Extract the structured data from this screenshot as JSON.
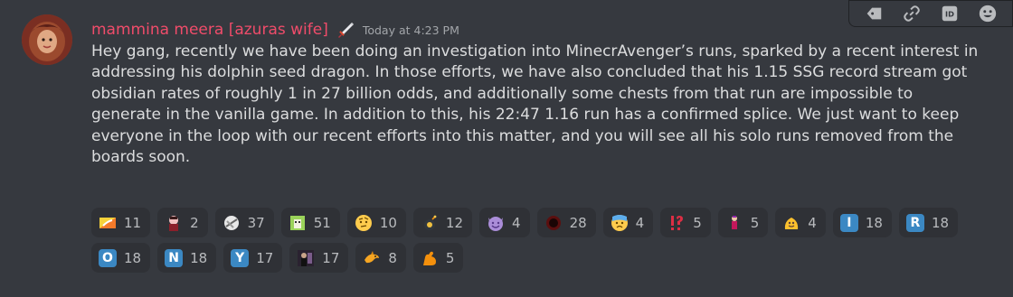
{
  "message": {
    "username": "mammina meera [azuras wife]",
    "timestamp": "Today at 4:23 PM",
    "content": "Hey gang, recently we have been doing an investigation into MinecrAvenger’s runs, sparked by a recent interest in addressing his dolphin seed dragon. In those efforts, we have also concluded that his 1.15 SSG record stream got obsidian rates of roughly 1 in 27 billion odds, and additionally some chests from that run are impossible to generate in the vanilla game. In addition to this, his 22:47 1.16 run has a confirmed splice. We just want to keep everyone in the loop with our recent efforts into this matter, and you will see all his solo runs removed from the boards soon.",
    "colors": {
      "username": "#f04c6a",
      "background": "#36393f",
      "reaction_bg": "#2f3136"
    }
  },
  "toolbar": {
    "buttons": [
      "tag-icon",
      "link-icon",
      "id-icon",
      "emoji-icon"
    ]
  },
  "reactions": [
    {
      "emoji": "flag-bhutan",
      "count": "11"
    },
    {
      "emoji": "custom-character",
      "count": "2"
    },
    {
      "emoji": "custom-wrapped",
      "count": "37"
    },
    {
      "emoji": "custom-green-block",
      "count": "51"
    },
    {
      "emoji": "face-with-raised-eyebrow",
      "count": "10"
    },
    {
      "emoji": "custom-bomb-face",
      "count": "12"
    },
    {
      "emoji": "smiling-imp",
      "count": "4"
    },
    {
      "emoji": "custom-dark-orb",
      "count": "28"
    },
    {
      "emoji": "anxious-face",
      "count": "4"
    },
    {
      "emoji": "exclamation-question",
      "count": "5"
    },
    {
      "emoji": "custom-figure",
      "count": "5"
    },
    {
      "emoji": "custom-yellow-blob",
      "count": "4"
    },
    {
      "emoji": "regional-i",
      "letter": "I",
      "count": "18"
    },
    {
      "emoji": "regional-r",
      "letter": "R",
      "count": "18"
    },
    {
      "emoji": "regional-o",
      "letter": "O",
      "count": "18"
    },
    {
      "emoji": "regional-n",
      "letter": "N",
      "count": "18"
    },
    {
      "emoji": "regional-y",
      "letter": "Y",
      "count": "17"
    },
    {
      "emoji": "custom-photo",
      "count": "17"
    },
    {
      "emoji": "custom-dolphin",
      "count": "8"
    },
    {
      "emoji": "flexed-biceps",
      "count": "5"
    }
  ]
}
